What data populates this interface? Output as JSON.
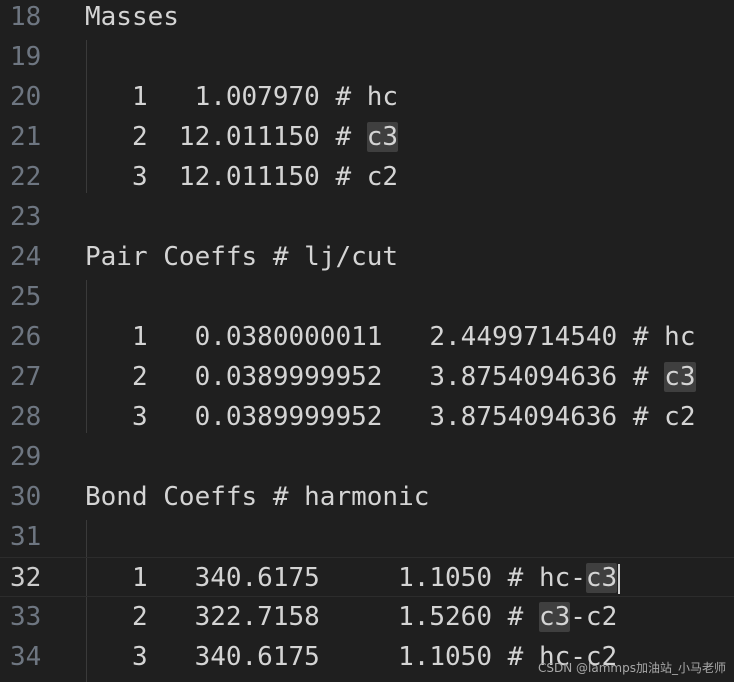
{
  "lines": [
    {
      "n": "18",
      "parts": [
        {
          "t": "Masses"
        }
      ]
    },
    {
      "n": "19",
      "parts": []
    },
    {
      "n": "20",
      "parts": [
        {
          "t": "   1   1.007970 # hc"
        }
      ]
    },
    {
      "n": "21",
      "parts": [
        {
          "t": "   2  12.011150 # "
        },
        {
          "t": "c3",
          "hl": true
        }
      ]
    },
    {
      "n": "22",
      "parts": [
        {
          "t": "   3  12.011150 # c2"
        }
      ]
    },
    {
      "n": "23",
      "parts": []
    },
    {
      "n": "24",
      "parts": [
        {
          "t": "Pair Coeffs # lj/cut"
        }
      ]
    },
    {
      "n": "25",
      "parts": []
    },
    {
      "n": "26",
      "parts": [
        {
          "t": "   1   0.0380000011   2.4499714540 # hc"
        }
      ]
    },
    {
      "n": "27",
      "parts": [
        {
          "t": "   2   0.0389999952   3.8754094636 # "
        },
        {
          "t": "c3",
          "hl": true
        }
      ]
    },
    {
      "n": "28",
      "parts": [
        {
          "t": "   3   0.0389999952   3.8754094636 # c2"
        }
      ]
    },
    {
      "n": "29",
      "parts": []
    },
    {
      "n": "30",
      "parts": [
        {
          "t": "Bond Coeffs # harmonic"
        }
      ]
    },
    {
      "n": "31",
      "parts": []
    },
    {
      "n": "32",
      "current": true,
      "parts": [
        {
          "t": "   1   340.6175     1.1050 # hc-"
        },
        {
          "t": "c3",
          "hl": true
        }
      ]
    },
    {
      "n": "33",
      "parts": [
        {
          "t": "   2   322.7158     1.5260 # "
        },
        {
          "t": "c3",
          "hl": true
        },
        {
          "t": "-c2"
        }
      ]
    },
    {
      "n": "34",
      "parts": [
        {
          "t": "   3   340.6175     1.1050 # hc-c2"
        }
      ]
    }
  ],
  "watermark": "CSDN @lammps加油站_小马老师"
}
